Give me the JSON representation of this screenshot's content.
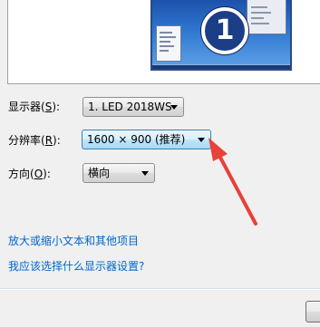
{
  "display_settings": {
    "monitor_preview": {
      "badge_number": "1"
    },
    "display_label": "显示器(S):",
    "display_label_parts": {
      "before": "显示器(",
      "key": "S",
      "after": "):"
    },
    "display_value": "1. LED 2018WS",
    "resolution_label_parts": {
      "before": "分辨率(",
      "key": "R",
      "after": "):"
    },
    "resolution_value": "1600 × 900 (推荐)",
    "orientation_label_parts": {
      "before": "方向(",
      "key": "O",
      "after": "):"
    },
    "orientation_value": "横向",
    "link_text_size": "放大或缩小文本和其他项目",
    "link_which_settings": "我应该选择什么显示器设置?"
  },
  "colors": {
    "link": "#0066cc",
    "annotation_arrow": "#e8413a",
    "focused_combo": "#3c7fb1"
  },
  "icons": [
    "monitor-preview",
    "dropdown-arrow-icon",
    "red-arrow-annotation"
  ]
}
